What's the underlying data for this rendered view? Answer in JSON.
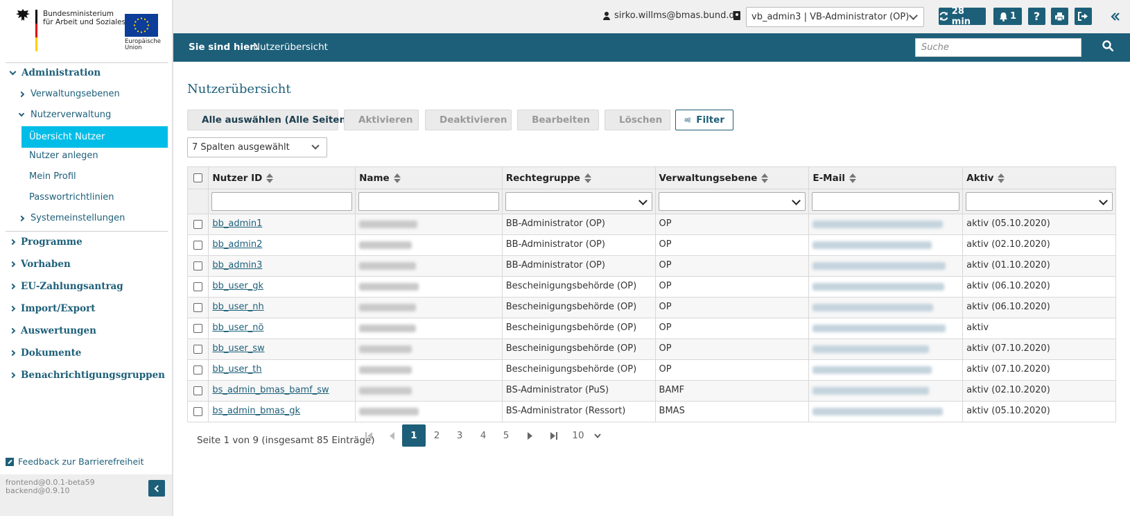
{
  "brand": {
    "ministry_line1": "Bundesministerium",
    "ministry_line2": "für Arbeit und Soziales",
    "eu_line1": "Europäische",
    "eu_line2": "Union"
  },
  "sidebar": {
    "administration": "Administration",
    "verwaltungsebenen": "Verwaltungsebenen",
    "nutzerverwaltung": "Nutzerverwaltung",
    "uebersicht_nutzer": "Übersicht Nutzer",
    "nutzer_anlegen": "Nutzer anlegen",
    "mein_profil": "Mein Profil",
    "passwortrichtlinien": "Passwortrichtlinien",
    "systemeinstellungen": "Systemeinstellungen",
    "programme": "Programme",
    "vorhaben": "Vorhaben",
    "eu_zahlungsantrag": "EU-Zahlungsantrag",
    "import_export": "Import/Export",
    "auswertungen": "Auswertungen",
    "dokumente": "Dokumente",
    "benachrichtigungsgruppen": "Benachrichtigungsgruppen",
    "feedback": "Feedback zur Barrierefreiheit",
    "version_frontend": "frontend@0.0.1-beta59",
    "version_backend": "backend@0.9.10"
  },
  "topbar": {
    "user_email": "sirko.willms@bmas.bund.de",
    "role": "vb_admin3 | VB-Administrator (OP)",
    "session_timer": "28 min",
    "notifications": "1",
    "help": "?",
    "accent": "#1d5f79"
  },
  "breadcrumb": {
    "label": "Sie sind hier:",
    "current": "Nutzerübersicht",
    "search_placeholder": "Suche"
  },
  "main": {
    "title": "Nutzerübersicht",
    "actions": {
      "select_all": "Alle auswählen (Alle Seiten)",
      "activate": "Aktivieren",
      "deactivate": "Deaktivieren",
      "edit": "Bearbeiten",
      "delete": "Löschen",
      "filter": "Filter"
    },
    "column_select": "7 Spalten ausgewählt"
  },
  "table": {
    "columns": [
      "Nutzer ID",
      "Name",
      "Rechtegruppe",
      "Verwaltungsebene",
      "E-Mail",
      "Aktiv"
    ],
    "rows": [
      {
        "id": "bb_admin1",
        "group": "BB-Administrator (OP)",
        "level": "OP",
        "active": "aktiv (05.10.2020)"
      },
      {
        "id": "bb_admin2",
        "group": "BB-Administrator (OP)",
        "level": "OP",
        "active": "aktiv (02.10.2020)"
      },
      {
        "id": "bb_admin3",
        "group": "BB-Administrator (OP)",
        "level": "OP",
        "active": "aktiv (01.10.2020)"
      },
      {
        "id": "bb_user_gk",
        "group": "Bescheinigungsbehörde (OP)",
        "level": "OP",
        "active": "aktiv (06.10.2020)"
      },
      {
        "id": "bb_user_nh",
        "group": "Bescheinigungsbehörde (OP)",
        "level": "OP",
        "active": "aktiv (06.10.2020)"
      },
      {
        "id": "bb_user_nö",
        "group": "Bescheinigungsbehörde (OP)",
        "level": "OP",
        "active": "aktiv"
      },
      {
        "id": "bb_user_sw",
        "group": "Bescheinigungsbehörde (OP)",
        "level": "OP",
        "active": "aktiv (07.10.2020)"
      },
      {
        "id": "bb_user_th",
        "group": "Bescheinigungsbehörde (OP)",
        "level": "OP",
        "active": "aktiv (07.10.2020)"
      },
      {
        "id": "bs_admin_bmas_bamf_sw",
        "group": "BS-Administrator (PuS)",
        "level": "BAMF",
        "active": "aktiv (02.10.2020)"
      },
      {
        "id": "bs_admin_bmas_gk",
        "group": "BS-Administrator (Ressort)",
        "level": "BMAS",
        "active": "aktiv (05.10.2020)"
      }
    ]
  },
  "pagination": {
    "info": "Seite 1 von 9 (insgesamt 85 Einträge)",
    "pages": [
      "1",
      "2",
      "3",
      "4",
      "5"
    ],
    "page_size": "10"
  }
}
